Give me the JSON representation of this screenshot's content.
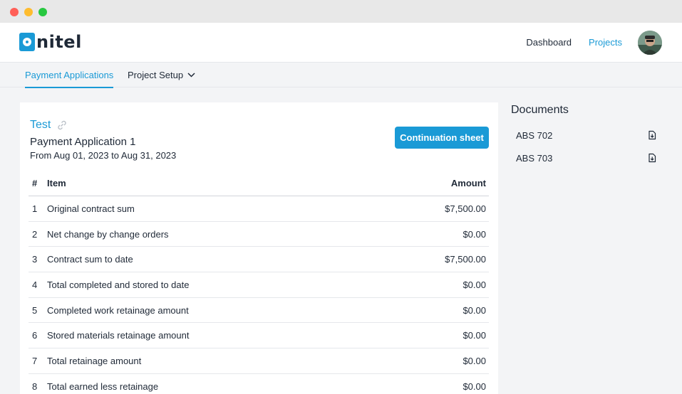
{
  "brand": {
    "name": "nitel",
    "accent": "#1a9ad6"
  },
  "topnav": {
    "links": [
      {
        "label": "Dashboard",
        "active": false
      },
      {
        "label": "Projects",
        "active": true
      }
    ]
  },
  "subnav": {
    "tabs": [
      {
        "label": "Payment Applications",
        "active": true
      },
      {
        "label": "Project Setup",
        "active": false,
        "dropdown": true
      }
    ]
  },
  "card": {
    "title": "Test",
    "subtitle": "Payment Application 1",
    "dates": "From Aug 01, 2023 to Aug 31, 2023",
    "button_label": "Continuation sheet",
    "columns": {
      "num": "#",
      "item": "Item",
      "amount": "Amount"
    },
    "rows": [
      {
        "num": "1",
        "item": "Original contract sum",
        "amount": "$7,500.00"
      },
      {
        "num": "2",
        "item": "Net change by change orders",
        "amount": "$0.00"
      },
      {
        "num": "3",
        "item": "Contract sum to date",
        "amount": "$7,500.00"
      },
      {
        "num": "4",
        "item": "Total completed and stored to date",
        "amount": "$0.00"
      },
      {
        "num": "5",
        "item": "Completed work retainage amount",
        "amount": "$0.00"
      },
      {
        "num": "6",
        "item": "Stored materials retainage amount",
        "amount": "$0.00"
      },
      {
        "num": "7",
        "item": "Total retainage amount",
        "amount": "$0.00"
      },
      {
        "num": "8",
        "item": "Total earned less retainage",
        "amount": "$0.00"
      }
    ]
  },
  "documents": {
    "title": "Documents",
    "items": [
      {
        "name": "ABS 702",
        "icon": "file-download-icon"
      },
      {
        "name": "ABS 703",
        "icon": "file-download-icon"
      }
    ]
  }
}
